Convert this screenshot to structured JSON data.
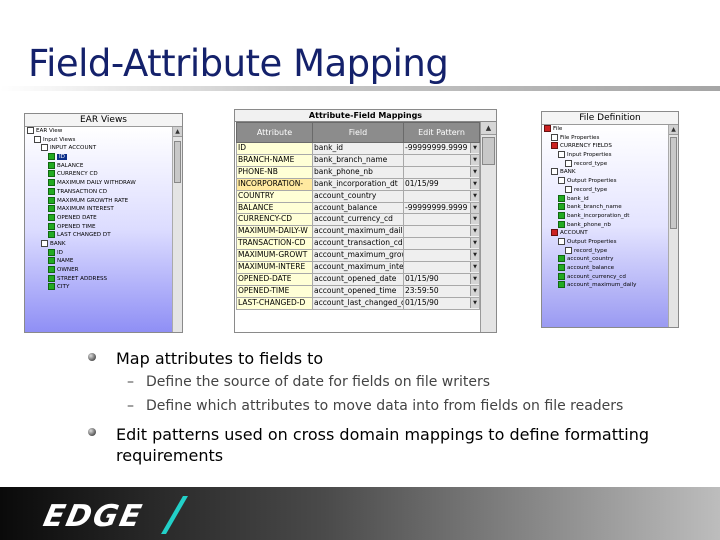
{
  "title": "Field-Attribute Mapping",
  "left_panel": {
    "header": "EAR Views",
    "rows": [
      {
        "label": "EAR View",
        "icon": "box",
        "indent": 0,
        "selected": false
      },
      {
        "label": "Input Views",
        "icon": "box",
        "indent": 1,
        "selected": false
      },
      {
        "label": "INPUT ACCOUNT",
        "icon": "box",
        "indent": 2,
        "selected": false
      },
      {
        "label": "ID",
        "icon": "green",
        "indent": 3,
        "selected": true
      },
      {
        "label": "BALANCE",
        "icon": "green",
        "indent": 3,
        "selected": false
      },
      {
        "label": "CURRENCY CD",
        "icon": "green",
        "indent": 3,
        "selected": false
      },
      {
        "label": "MAXIMUM DAILY WITHDRAW",
        "icon": "green",
        "indent": 3,
        "selected": false
      },
      {
        "label": "TRANSACTION CD",
        "icon": "green",
        "indent": 3,
        "selected": false
      },
      {
        "label": "MAXIMUM GROWTH RATE",
        "icon": "green",
        "indent": 3,
        "selected": false
      },
      {
        "label": "MAXIMUM INTEREST",
        "icon": "green",
        "indent": 3,
        "selected": false
      },
      {
        "label": "OPENED DATE",
        "icon": "green",
        "indent": 3,
        "selected": false
      },
      {
        "label": "OPENED TIME",
        "icon": "green",
        "indent": 3,
        "selected": false
      },
      {
        "label": "LAST CHANGED DT",
        "icon": "green",
        "indent": 3,
        "selected": false
      },
      {
        "label": "BANK",
        "icon": "box",
        "indent": 2,
        "selected": false
      },
      {
        "label": "ID",
        "icon": "green",
        "indent": 3,
        "selected": false
      },
      {
        "label": "NAME",
        "icon": "green",
        "indent": 3,
        "selected": false
      },
      {
        "label": "OWNER",
        "icon": "green",
        "indent": 3,
        "selected": false
      },
      {
        "label": "STREET ADDRESS",
        "icon": "green",
        "indent": 3,
        "selected": false
      },
      {
        "label": "CITY",
        "icon": "green",
        "indent": 3,
        "selected": false
      }
    ]
  },
  "mapping": {
    "header": "Attribute-Field Mappings",
    "columns": [
      "Attribute",
      "Field",
      "Edit Pattern"
    ],
    "rows": [
      {
        "attribute": "ID",
        "field": "bank_id",
        "pattern": "-99999999.9999"
      },
      {
        "attribute": "BRANCH-NAME",
        "field": "bank_branch_name",
        "pattern": ""
      },
      {
        "attribute": "PHONE-NB",
        "field": "bank_phone_nb",
        "pattern": ""
      },
      {
        "attribute": "INCORPORATION-",
        "field": "bank_incorporation_dt",
        "pattern": "01/15/99"
      },
      {
        "attribute": "COUNTRY",
        "field": "account_country",
        "pattern": ""
      },
      {
        "attribute": "BALANCE",
        "field": "account_balance",
        "pattern": "-99999999.9999"
      },
      {
        "attribute": "CURRENCY-CD",
        "field": "account_currency_cd",
        "pattern": ""
      },
      {
        "attribute": "MAXIMUM-DAILY-W",
        "field": "account_maximum_daily",
        "pattern": ""
      },
      {
        "attribute": "TRANSACTION-CD",
        "field": "account_transaction_cd",
        "pattern": ""
      },
      {
        "attribute": "MAXIMUM-GROWT",
        "field": "account_maximum_grow",
        "pattern": ""
      },
      {
        "attribute": "MAXIMUM-INTERE",
        "field": "account_maximum_inter",
        "pattern": ""
      },
      {
        "attribute": "OPENED-DATE",
        "field": "account_opened_date",
        "pattern": "01/15/90"
      },
      {
        "attribute": "OPENED-TIME",
        "field": "account_opened_time",
        "pattern": "23:59:50"
      },
      {
        "attribute": "LAST-CHANGED-D",
        "field": "account_last_changed_d",
        "pattern": "01/15/90"
      }
    ]
  },
  "right_panel": {
    "header": "File Definition",
    "rows": [
      {
        "label": "File",
        "icon": "red",
        "indent": 0
      },
      {
        "label": "File Properties",
        "icon": "box",
        "indent": 1
      },
      {
        "label": "CURRENCY FIELDS",
        "icon": "red",
        "indent": 1
      },
      {
        "label": "Input Properties",
        "icon": "box",
        "indent": 2
      },
      {
        "label": "record_type",
        "icon": "box",
        "indent": 3
      },
      {
        "label": "BANK",
        "icon": "box",
        "indent": 1
      },
      {
        "label": "Output Properties",
        "icon": "box",
        "indent": 2
      },
      {
        "label": "record_type",
        "icon": "box",
        "indent": 3
      },
      {
        "label": "bank_id",
        "icon": "green",
        "indent": 2
      },
      {
        "label": "bank_branch_name",
        "icon": "green",
        "indent": 2
      },
      {
        "label": "bank_incorporation_dt",
        "icon": "green",
        "indent": 2
      },
      {
        "label": "bank_phone_nb",
        "icon": "green",
        "indent": 2
      },
      {
        "label": "ACCOUNT",
        "icon": "red",
        "indent": 1
      },
      {
        "label": "Output Properties",
        "icon": "box",
        "indent": 2
      },
      {
        "label": "record_type",
        "icon": "box",
        "indent": 3
      },
      {
        "label": "account_country",
        "icon": "green",
        "indent": 2
      },
      {
        "label": "account_balance",
        "icon": "green",
        "indent": 2
      },
      {
        "label": "account_currency_cd",
        "icon": "green",
        "indent": 2
      },
      {
        "label": "account_maximum_daily",
        "icon": "green",
        "indent": 2
      }
    ]
  },
  "bullets": {
    "b1": "Map attributes to fields to",
    "sub1": "Define the source of date for fields on file writers",
    "sub2": "Define which attributes to move data into from fields on file readers",
    "b2": "Edit patterns used on cross domain mappings to define formatting requirements",
    "dash": "–"
  },
  "footer": {
    "logo_text": "EDGE"
  },
  "colors": {
    "title": "#14216b",
    "accent": "#22d0c8",
    "selection": "#0b2d8a"
  }
}
